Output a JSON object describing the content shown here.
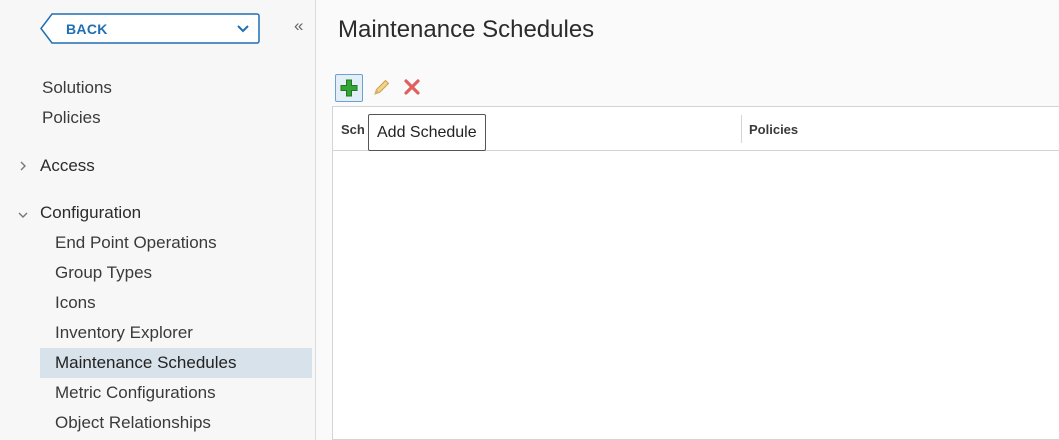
{
  "sidebar": {
    "back_label": "BACK",
    "items": [
      {
        "label": "Solutions"
      },
      {
        "label": "Policies"
      }
    ],
    "groups": [
      {
        "label": "Access",
        "expanded": false
      },
      {
        "label": "Configuration",
        "expanded": true,
        "items": [
          {
            "label": "End Point Operations"
          },
          {
            "label": "Group Types"
          },
          {
            "label": "Icons"
          },
          {
            "label": "Inventory Explorer"
          },
          {
            "label": "Maintenance Schedules",
            "active": true
          },
          {
            "label": "Metric Configurations"
          },
          {
            "label": "Object Relationships"
          }
        ]
      }
    ]
  },
  "main": {
    "title": "Maintenance Schedules",
    "toolbar": {
      "add_icon": "plus-icon",
      "edit_icon": "pencil-icon",
      "delete_icon": "x-icon",
      "tooltip": "Add Schedule"
    },
    "grid": {
      "columns": [
        "Sch",
        "Policies"
      ],
      "rows": []
    }
  },
  "colors": {
    "accent": "#1e6fb3",
    "active_bg": "#d8e2ea",
    "add_green": "#2e9a2e",
    "delete_red": "#d9534f",
    "edit_yellow": "#e6c36a"
  }
}
